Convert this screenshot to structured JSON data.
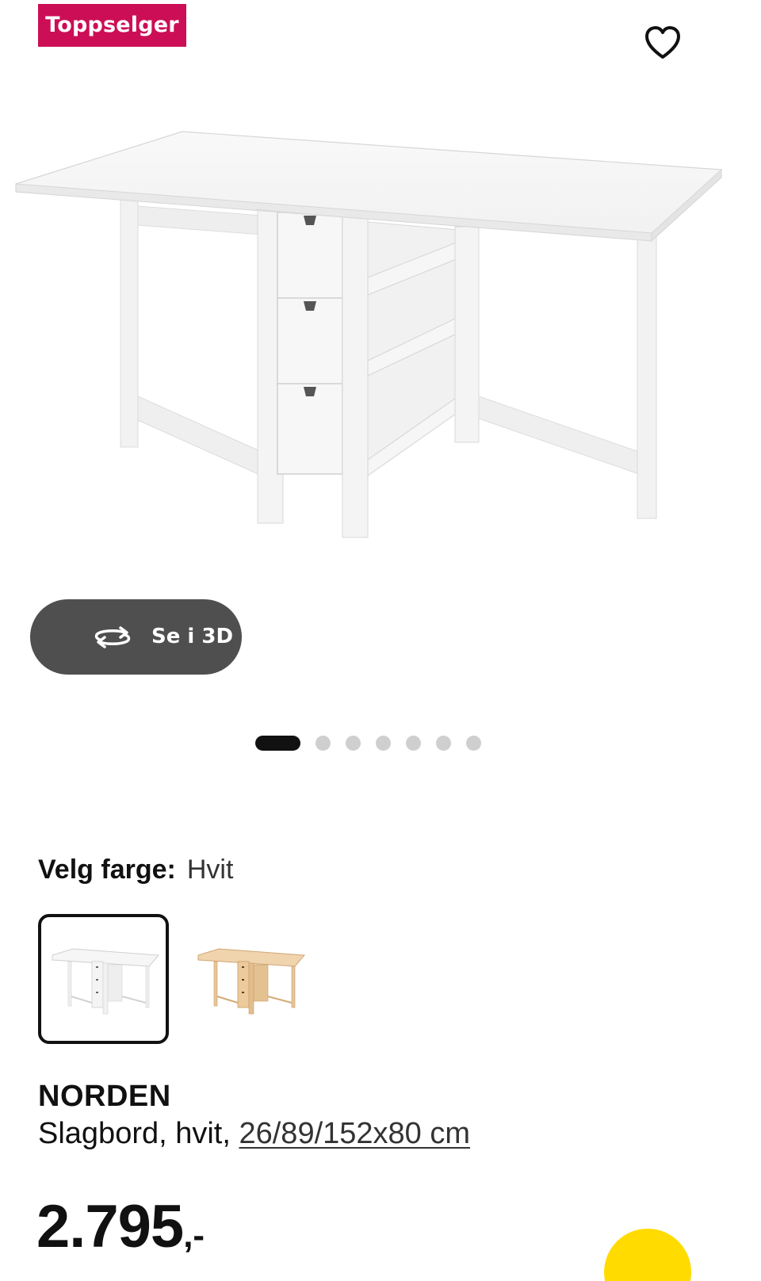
{
  "badge": {
    "label": "Toppselger"
  },
  "favorite": {
    "icon": "heart-icon"
  },
  "product_image": {
    "alt": ""
  },
  "view_3d": {
    "label": "Se i 3D",
    "icon": "rotate-arrows-icon"
  },
  "gallery": {
    "total": 7,
    "active_index": 0
  },
  "color_select": {
    "label": "Velg farge:",
    "value": "Hvit",
    "options": [
      {
        "selected": true,
        "swatch_color": "#f3f3f3"
      },
      {
        "selected": false,
        "swatch_color": "#e6c79f"
      }
    ]
  },
  "product": {
    "name": "NORDEN",
    "description_prefix": "Slagbord, hvit,",
    "dimensions_link": "26/89/152x80 cm",
    "price_main": "2.795",
    "price_suffix": ",-"
  },
  "colors": {
    "badge_bg": "#cc0e56",
    "button_dark": "#4f4f4f",
    "fab_yellow": "#ffdb00"
  }
}
